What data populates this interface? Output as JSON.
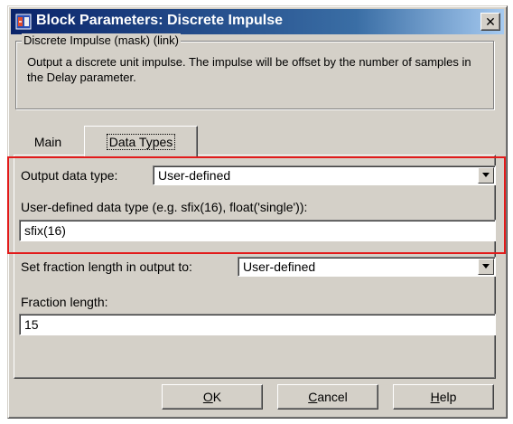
{
  "window": {
    "title": "Block Parameters: Discrete  Impulse",
    "close_glyph": "✕"
  },
  "group": {
    "legend": "Discrete Impulse  (mask) (link)",
    "description": "Output a discrete unit impulse.  The impulse will be offset by the number of samples in the Delay parameter."
  },
  "tabs": [
    {
      "label": "Main",
      "selected": false
    },
    {
      "label": "Data Types",
      "selected": true
    }
  ],
  "fields": {
    "output_data_type": {
      "label": "Output data type:",
      "value": "User-defined"
    },
    "user_defined_type": {
      "label": "User-defined data type (e.g. sfix(16), float('single')):",
      "value": "sfix(16)"
    },
    "fraction_mode": {
      "label": "Set fraction length in output to:",
      "value": "User-defined"
    },
    "fraction_length": {
      "label": "Fraction length:",
      "value": "15"
    }
  },
  "buttons": {
    "ok": {
      "mnemonic": "O",
      "rest": "K"
    },
    "cancel": {
      "mnemonic": "C",
      "rest": "ancel"
    },
    "help": {
      "mnemonic": "H",
      "rest": "elp"
    }
  },
  "colors": {
    "title_gradient_start": "#0a246a",
    "title_gradient_end": "#a6caf0",
    "dialog_face": "#d4d0c8",
    "highlight_box": "#e21a1a"
  },
  "icons": [
    "simulink-block-icon",
    "close-icon",
    "dropdown-arrow-icon"
  ]
}
